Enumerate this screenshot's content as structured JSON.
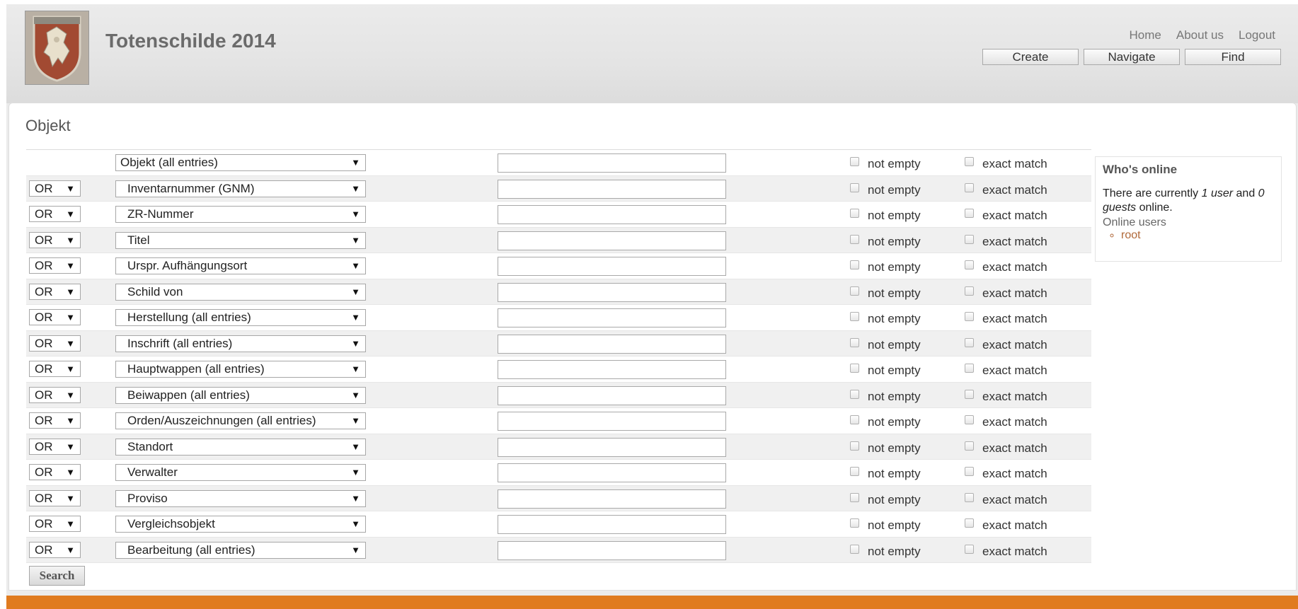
{
  "site": {
    "name": "Totenschilde 2014"
  },
  "secondary_menu": [
    "Home",
    "About us",
    "Logout"
  ],
  "primary_menu": [
    "Create",
    "Navigate",
    "Find"
  ],
  "page": {
    "title": "Objekt"
  },
  "search_rows": [
    {
      "operator": "",
      "field": "Objekt (all entries)",
      "value": "",
      "not_empty_label": "not empty",
      "exact_match_label": "exact match"
    },
    {
      "operator": "OR",
      "field": "Inventarnummer (GNM)",
      "value": "",
      "not_empty_label": "not empty",
      "exact_match_label": "exact match"
    },
    {
      "operator": "OR",
      "field": "ZR-Nummer",
      "value": "",
      "not_empty_label": "not empty",
      "exact_match_label": "exact match"
    },
    {
      "operator": "OR",
      "field": "Titel",
      "value": "",
      "not_empty_label": "not empty",
      "exact_match_label": "exact match"
    },
    {
      "operator": "OR",
      "field": "Urspr. Aufhängungsort",
      "value": "",
      "not_empty_label": "not empty",
      "exact_match_label": "exact match"
    },
    {
      "operator": "OR",
      "field": "Schild von",
      "value": "",
      "not_empty_label": "not empty",
      "exact_match_label": "exact match"
    },
    {
      "operator": "OR",
      "field": "Herstellung (all entries)",
      "value": "",
      "not_empty_label": "not empty",
      "exact_match_label": "exact match"
    },
    {
      "operator": "OR",
      "field": "Inschrift (all entries)",
      "value": "",
      "not_empty_label": "not empty",
      "exact_match_label": "exact match"
    },
    {
      "operator": "OR",
      "field": "Hauptwappen (all entries)",
      "value": "",
      "not_empty_label": "not empty",
      "exact_match_label": "exact match"
    },
    {
      "operator": "OR",
      "field": "Beiwappen (all entries)",
      "value": "",
      "not_empty_label": "not empty",
      "exact_match_label": "exact match"
    },
    {
      "operator": "OR",
      "field": "Orden/Auszeichnungen (all entries)",
      "value": "",
      "not_empty_label": "not empty",
      "exact_match_label": "exact match"
    },
    {
      "operator": "OR",
      "field": "Standort",
      "value": "",
      "not_empty_label": "not empty",
      "exact_match_label": "exact match"
    },
    {
      "operator": "OR",
      "field": "Verwalter",
      "value": "",
      "not_empty_label": "not empty",
      "exact_match_label": "exact match"
    },
    {
      "operator": "OR",
      "field": "Proviso",
      "value": "",
      "not_empty_label": "not empty",
      "exact_match_label": "exact match"
    },
    {
      "operator": "OR",
      "field": "Vergleichsobjekt",
      "value": "",
      "not_empty_label": "not empty",
      "exact_match_label": "exact match"
    },
    {
      "operator": "OR",
      "field": "Bearbeitung (all entries)",
      "value": "",
      "not_empty_label": "not empty",
      "exact_match_label": "exact match"
    }
  ],
  "search_button": "Search",
  "whos_online": {
    "title": "Who's online",
    "text_prefix": "There are currently ",
    "users_count": "1 user",
    "text_middle": " and ",
    "guests_count": "0 guests",
    "text_suffix": " online.",
    "online_users_title": "Online users",
    "users": [
      "root"
    ]
  },
  "icons": {
    "dropdown_arrow": "triangle-down-icon",
    "logo": "coat-of-arms-logo"
  },
  "colors": {
    "accent": "#e07b1f",
    "link": "#b0693a",
    "header_bg": "#e4e4e4"
  }
}
